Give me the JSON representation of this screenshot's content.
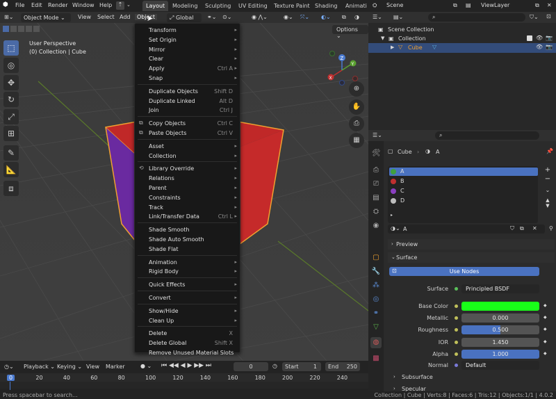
{
  "menubar": {
    "items": [
      "File",
      "Edit",
      "Render",
      "Window",
      "Help"
    ],
    "tabs": [
      "Layout",
      "Modeling",
      "Sculpting",
      "UV Editing",
      "Texture Paint",
      "Shading",
      "Animati"
    ],
    "active_tab": "Layout",
    "scene": "Scene",
    "view_layer": "ViewLayer"
  },
  "viewport": {
    "mode": "Object Mode",
    "menus": [
      "View",
      "Select",
      "Add",
      "Object"
    ],
    "transform": "Global",
    "options": "Options",
    "overlay_title": "User Perspective",
    "overlay_sub": "(0) Collection | Cube"
  },
  "object_menu": [
    {
      "label": "Transform",
      "shortcut": "",
      "sub": true
    },
    {
      "label": "Set Origin",
      "shortcut": "",
      "sub": true
    },
    {
      "label": "Mirror",
      "shortcut": "",
      "sub": true
    },
    {
      "label": "Clear",
      "shortcut": "",
      "sub": true
    },
    {
      "label": "Apply",
      "shortcut": "Ctrl A",
      "sub": true
    },
    {
      "label": "Snap",
      "shortcut": "",
      "sub": true
    },
    {
      "sep": true
    },
    {
      "label": "Duplicate Objects",
      "shortcut": "Shift D"
    },
    {
      "label": "Duplicate Linked",
      "shortcut": "Alt D"
    },
    {
      "label": "Join",
      "shortcut": "Ctrl J"
    },
    {
      "sep": true
    },
    {
      "label": "Copy Objects",
      "shortcut": "Ctrl C",
      "icon": "⧉"
    },
    {
      "label": "Paste Objects",
      "shortcut": "Ctrl V",
      "icon": "⧉"
    },
    {
      "sep": true
    },
    {
      "label": "Asset",
      "shortcut": "",
      "sub": true
    },
    {
      "label": "Collection",
      "shortcut": "",
      "sub": true
    },
    {
      "sep": true
    },
    {
      "label": "Library Override",
      "shortcut": "",
      "sub": true,
      "icon": "⟲"
    },
    {
      "label": "Relations",
      "shortcut": "",
      "sub": true
    },
    {
      "label": "Parent",
      "shortcut": "",
      "sub": true
    },
    {
      "label": "Constraints",
      "shortcut": "",
      "sub": true
    },
    {
      "label": "Track",
      "shortcut": "",
      "sub": true
    },
    {
      "label": "Link/Transfer Data",
      "shortcut": "Ctrl L",
      "sub": true
    },
    {
      "sep": true
    },
    {
      "label": "Shade Smooth",
      "shortcut": ""
    },
    {
      "label": "Shade Auto Smooth",
      "shortcut": ""
    },
    {
      "label": "Shade Flat",
      "shortcut": ""
    },
    {
      "sep": true
    },
    {
      "label": "Animation",
      "shortcut": "",
      "sub": true
    },
    {
      "label": "Rigid Body",
      "shortcut": "",
      "sub": true
    },
    {
      "sep": true
    },
    {
      "label": "Quick Effects",
      "shortcut": "",
      "sub": true
    },
    {
      "sep": true
    },
    {
      "label": "Convert",
      "shortcut": "",
      "sub": true
    },
    {
      "sep": true
    },
    {
      "label": "Show/Hide",
      "shortcut": "",
      "sub": true
    },
    {
      "label": "Clean Up",
      "shortcut": "",
      "sub": true
    },
    {
      "sep": true
    },
    {
      "label": "Delete",
      "shortcut": "X"
    },
    {
      "label": "Delete Global",
      "shortcut": "Shift X"
    },
    {
      "label": "Remove Unused Material Slots",
      "shortcut": ""
    }
  ],
  "outliner": {
    "rows": [
      {
        "label": "Scene Collection",
        "level": 0
      },
      {
        "label": "Collection",
        "level": 1
      },
      {
        "label": "Cube",
        "level": 2
      }
    ]
  },
  "properties": {
    "breadcrumb_object": "Cube",
    "breadcrumb_material": "A",
    "slots": [
      {
        "name": "A",
        "color": "#3fa03f"
      },
      {
        "name": "B",
        "color": "#c03030"
      },
      {
        "name": "C",
        "color": "#8a3fc0"
      },
      {
        "name": "D",
        "color": "#bdbdbd"
      }
    ],
    "material_name": "A",
    "preview": "Preview",
    "surface": "Surface",
    "use_nodes": "Use Nodes",
    "subsurface": "Subsurface",
    "specular": "Specular",
    "fields": [
      {
        "label": "Surface",
        "value": "Principled BSDF"
      },
      {
        "label": "Base Color",
        "value": ""
      },
      {
        "label": "Metallic",
        "value": "0.000"
      },
      {
        "label": "Roughness",
        "value": "0.500"
      },
      {
        "label": "IOR",
        "value": "1.450"
      },
      {
        "label": "Alpha",
        "value": "1.000"
      },
      {
        "label": "Normal",
        "value": "Default"
      }
    ]
  },
  "timeline": {
    "menus": [
      "Playback",
      "Keying",
      "View",
      "Marker"
    ],
    "current_frame": "0",
    "start_label": "Start",
    "start": "1",
    "end_label": "End",
    "end": "250",
    "ticks": [
      "0",
      "20",
      "40",
      "60",
      "80",
      "100",
      "120",
      "140",
      "160",
      "180",
      "200",
      "220",
      "240"
    ]
  },
  "status": {
    "left": "Press spacebar to search...",
    "right": "Collection | Cube | Verts:8 | Faces:6 | Tris:12 | Objects:1/1 | 4.0.2"
  }
}
